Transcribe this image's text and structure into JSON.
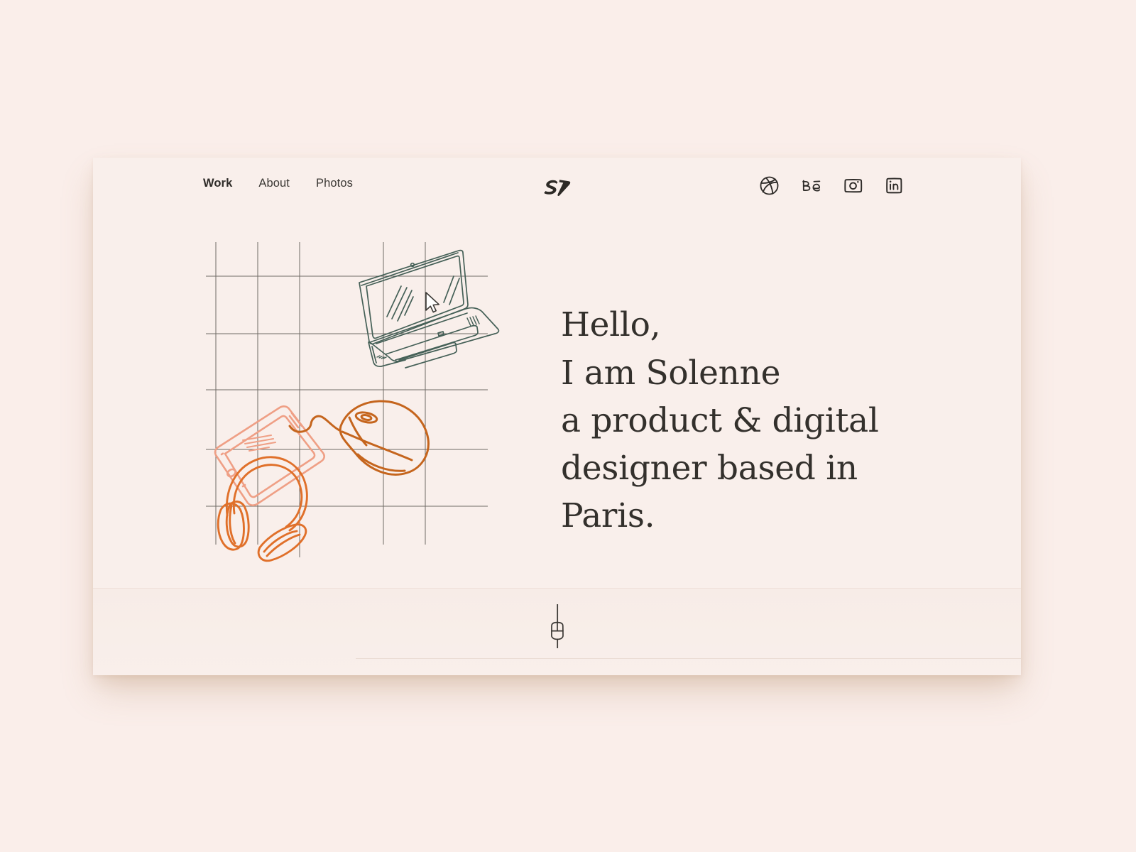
{
  "page": {
    "background_color": "#faeeea",
    "card_background_color": "#f9efeb",
    "text_color": "#33302c"
  },
  "nav": {
    "links": [
      {
        "label": "Work",
        "active": true
      },
      {
        "label": "About",
        "active": false
      },
      {
        "label": "Photos",
        "active": false
      }
    ],
    "logo": {
      "name": "sd-monogram-logo",
      "text": "SD",
      "color": "#2d2a26"
    },
    "social": [
      {
        "name": "dribbble-icon",
        "label": "Dribbble"
      },
      {
        "name": "behance-icon",
        "label": "Be"
      },
      {
        "name": "instagram-icon",
        "label": "Instagram"
      },
      {
        "name": "linkedin-icon",
        "label": "in"
      }
    ]
  },
  "hero": {
    "headline_lines": [
      "Hello,",
      "I am Solenne",
      "a product & digital",
      "designer based in",
      "Paris."
    ],
    "illustration": {
      "grid_color": "#58554f",
      "items": [
        {
          "name": "laptop-sketch",
          "color": "#456057"
        },
        {
          "name": "smartphone-sketch",
          "color": "#ef9f85"
        },
        {
          "name": "mouse-sketch",
          "color": "#c5651d"
        },
        {
          "name": "headphones-sketch",
          "color": "#e0702a"
        },
        {
          "name": "cursor-arrow",
          "color": "#3b3834"
        }
      ]
    }
  },
  "footer": {
    "scroll_cue": {
      "name": "scroll-down-mouse-icon",
      "color": "#3b3834"
    }
  }
}
